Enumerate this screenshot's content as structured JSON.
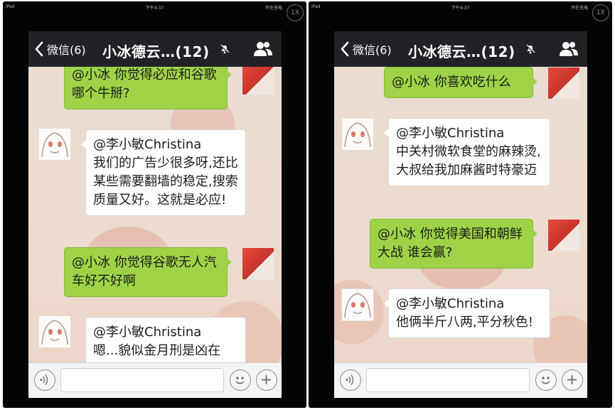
{
  "status_bar": {
    "carrier": "iPad",
    "time": "下午4:37",
    "battery": "不在充电"
  },
  "zoom_label": "1X",
  "navbar": {
    "back_label": "微信(6)",
    "title": "小冰德云…(12)"
  },
  "screens": [
    {
      "messages": [
        {
          "from": "me",
          "text": "@小冰 你觉得必应和谷歌 哪个牛掰?"
        },
        {
          "from": "other",
          "text": "@李小敏Christina\n我们的广告少很多呀,还比某些需要翻墙的稳定,搜索质量又好。这就是必应!"
        },
        {
          "from": "me",
          "text": "@小冰 你觉得谷歌无人汽车好不好啊"
        },
        {
          "from": "other",
          "text": "@李小敏Christina\n嗯...貌似金月刑是凶在"
        }
      ]
    },
    {
      "messages": [
        {
          "from": "me",
          "text": "@小冰 你喜欢吃什么"
        },
        {
          "from": "other",
          "text": "@李小敏Christina\n中关村微软食堂的麻辣烫,大叔给我加麻酱时特豪迈"
        },
        {
          "from": "me",
          "text": "@小冰 你觉得美国和朝鲜大战 谁会赢?"
        },
        {
          "from": "other",
          "text": "@李小敏Christina\n他俩半斤八两,平分秋色!"
        }
      ]
    }
  ],
  "icons": {
    "back": "chevron-left-icon",
    "mute": "mute-bell-icon",
    "members": "group-members-icon",
    "voice": "voice-input-icon",
    "emoji": "emoji-icon",
    "plus": "plus-icon"
  },
  "colors": {
    "navbar_bg": "#212227",
    "my_bubble": "#9ed347",
    "other_bubble": "#ffffff",
    "chat_bg": "#e9dcd1",
    "device_frame": "#050505"
  }
}
